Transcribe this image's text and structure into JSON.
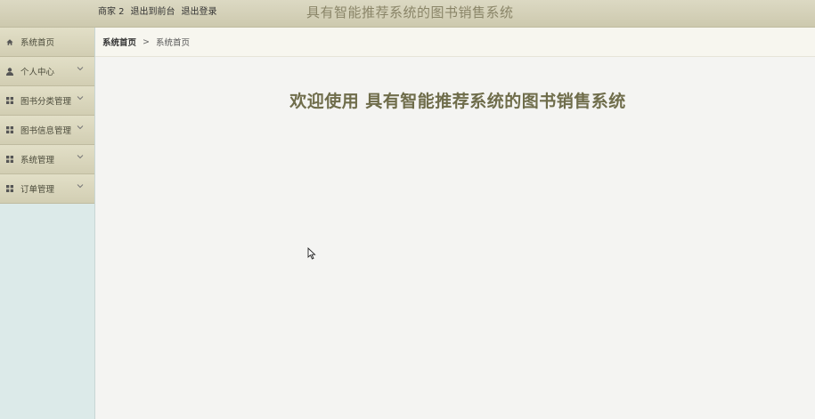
{
  "header": {
    "user_name": "商家 2",
    "back_to_front": "退出到前台",
    "logout": "退出登录",
    "title": "具有智能推荐系统的图书销售系统"
  },
  "sidebar": {
    "items": [
      {
        "label": "系统首页",
        "icon": "home-icon",
        "expandable": false
      },
      {
        "label": "个人中心",
        "icon": "user-icon",
        "expandable": true
      },
      {
        "label": "图书分类管理",
        "icon": "grid-icon",
        "expandable": true
      },
      {
        "label": "图书信息管理",
        "icon": "grid-icon",
        "expandable": true
      },
      {
        "label": "系统管理",
        "icon": "grid-icon",
        "expandable": true
      },
      {
        "label": "订单管理",
        "icon": "grid-icon",
        "expandable": true
      }
    ]
  },
  "breadcrumb": {
    "home": "系统首页",
    "separator": ">",
    "current": "系统首页"
  },
  "main": {
    "welcome": "欢迎使用 具有智能推荐系统的图书销售系统"
  },
  "colors": {
    "header_bg": "#d6d2b8",
    "sidebar_bg": "#dceae9",
    "welcome_text": "#6f6d4b"
  }
}
